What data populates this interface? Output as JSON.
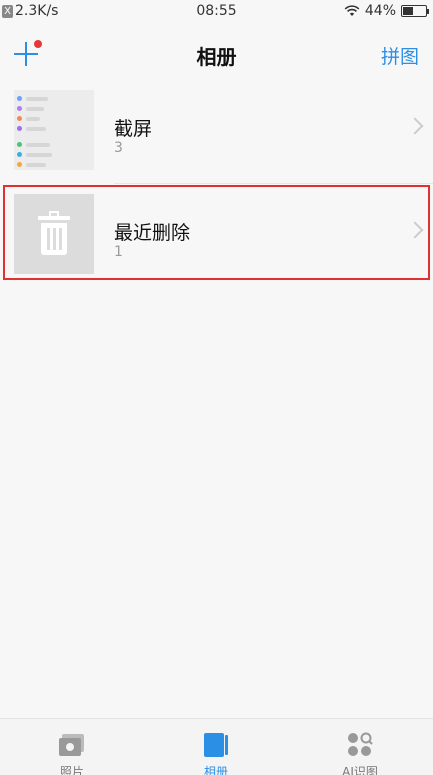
{
  "status_bar": {
    "left_badge": "X",
    "net_speed": "2.3K/s",
    "time": "08:55",
    "battery": "44%",
    "battery_level": 0.44
  },
  "nav": {
    "title": "相册",
    "right_action": "拼图"
  },
  "albums": [
    {
      "name": "截屏",
      "count": "3"
    },
    {
      "name": "最近删除",
      "count": "1"
    }
  ],
  "tabs": [
    {
      "label": "照片",
      "icon": "photo-icon"
    },
    {
      "label": "相册",
      "icon": "album-icon"
    },
    {
      "label": "AI识图",
      "icon": "ai-recognition-icon"
    }
  ],
  "colors": {
    "accent": "#2b8fe6",
    "highlight": "#e03030",
    "badge_dot": "#e53935"
  }
}
